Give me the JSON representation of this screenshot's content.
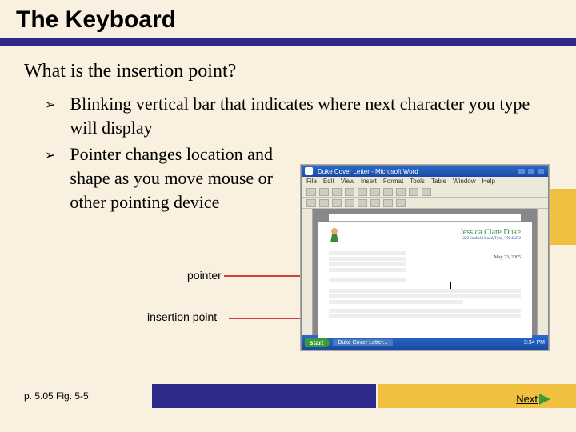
{
  "title": "The Keyboard",
  "subhead": "What is the insertion point?",
  "bullets": [
    "Blinking vertical bar that indicates where next character you type will display",
    "Pointer changes location and shape as you move mouse or other pointing device"
  ],
  "labels": {
    "pointer": "pointer",
    "insertion": "insertion point"
  },
  "footer": {
    "ref": "p. 5.05 Fig. 5-5",
    "next": "Next"
  },
  "word_mock": {
    "title": "Duke Cover Letter - Microsoft Word",
    "menu": [
      "File",
      "Edit",
      "View",
      "Insert",
      "Format",
      "Tools",
      "Table",
      "Window",
      "Help"
    ],
    "doc_name": "Jessica Clare Duke",
    "doc_addr": "220 Sunfield Road, Tyne, TX 43272",
    "doc_date": "May 23, 2005",
    "start": "start",
    "task_item": "Duke Cover Letter...",
    "clock": "3:34 PM"
  }
}
